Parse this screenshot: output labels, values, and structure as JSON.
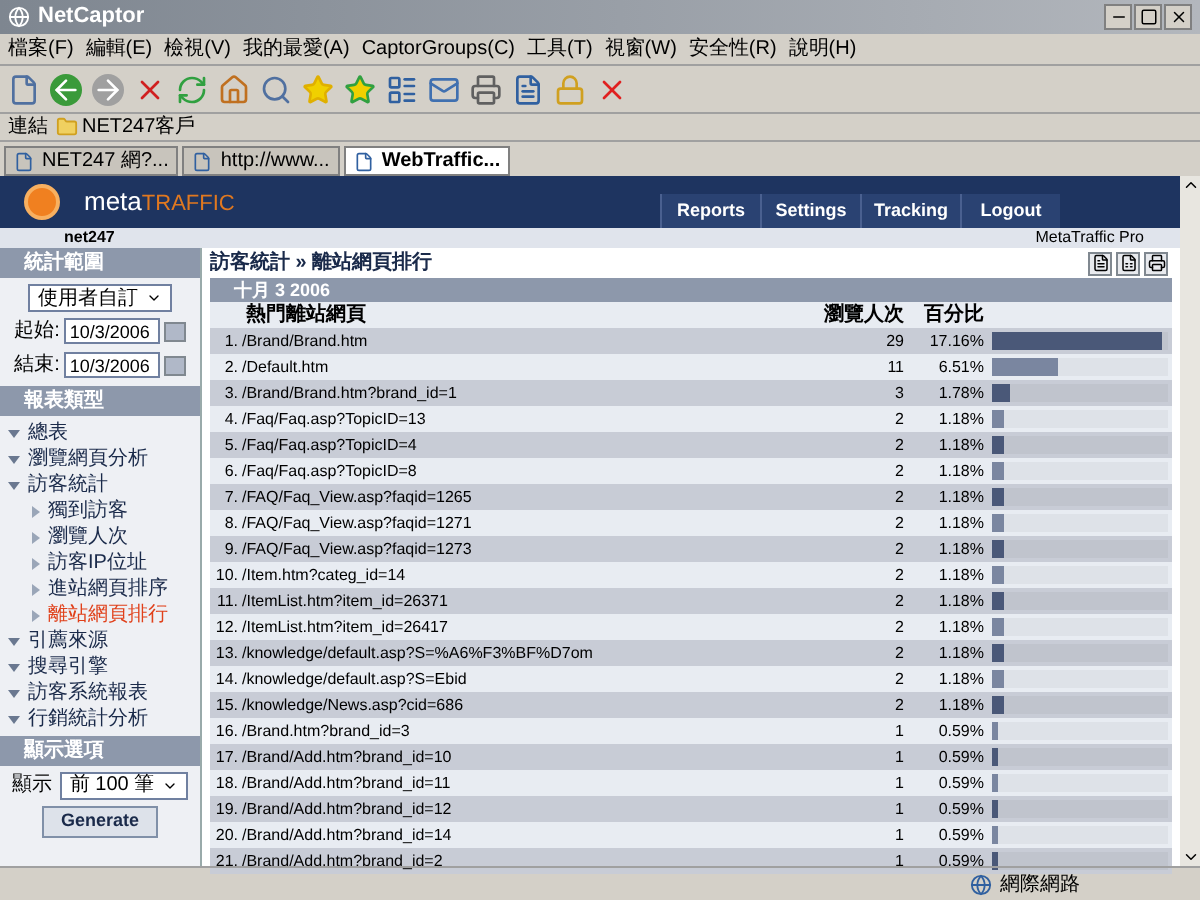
{
  "window": {
    "title": "NetCaptor"
  },
  "menu": [
    "檔案(F)",
    "編輯(E)",
    "檢視(V)",
    "我的最愛(A)",
    "CaptorGroups(C)",
    "工具(T)",
    "視窗(W)",
    "安全性(R)",
    "說明(H)"
  ],
  "links_bar": {
    "label": "連結",
    "items": [
      "NET247客戶"
    ]
  },
  "tabs": [
    {
      "label": "NET247 網?...",
      "selected": false
    },
    {
      "label": "http://www...",
      "selected": false
    },
    {
      "label": "WebTraffic...",
      "selected": true
    }
  ],
  "site": {
    "logo_prefix": "meta",
    "logo_suffix": "TRAFFIC",
    "nav": [
      "Reports",
      "Settings",
      "Tracking",
      "Logout"
    ],
    "account": "net247",
    "edition": "MetaTraffic Pro"
  },
  "sidebar": {
    "date_range": {
      "title": "統計範圍",
      "preset": "使用者自訂",
      "start_label": "起始:",
      "start": "10/3/2006",
      "end_label": "結束:",
      "end": "10/3/2006"
    },
    "report_types": {
      "title": "報表類型",
      "items": [
        {
          "label": "總表",
          "selected": false
        },
        {
          "label": "瀏覽網頁分析",
          "selected": false
        },
        {
          "label": "訪客統計",
          "selected": false,
          "children": [
            {
              "label": "獨到訪客",
              "selected": false
            },
            {
              "label": "瀏覽人次",
              "selected": false
            },
            {
              "label": "訪客IP位址",
              "selected": false
            },
            {
              "label": "進站網頁排序",
              "selected": false
            },
            {
              "label": "離站網頁排行",
              "selected": true
            }
          ]
        },
        {
          "label": "引薦來源",
          "selected": false
        },
        {
          "label": "搜尋引擎",
          "selected": false
        },
        {
          "label": "訪客系統報表",
          "selected": false
        },
        {
          "label": "行銷統計分析",
          "selected": false
        }
      ]
    },
    "display": {
      "title": "顯示選項",
      "label": "顯示",
      "value": "前 100 筆",
      "button": "Generate"
    }
  },
  "content": {
    "breadcrumb": "訪客統計 » 離站網頁排行",
    "table": {
      "date": "十月 3 2006",
      "columns": [
        "熱門離站網頁",
        "瀏覽人次",
        "百分比"
      ],
      "rows": [
        {
          "rank": "1.",
          "page": "/Brand/Brand.htm",
          "count": "29",
          "percent": "17.16%",
          "level": 0.97
        },
        {
          "rank": "2.",
          "page": "/Default.htm",
          "count": "11",
          "percent": "6.51%",
          "level": 0.38
        },
        {
          "rank": "3.",
          "page": "/Brand/Brand.htm?brand_id=1",
          "count": "3",
          "percent": "1.78%",
          "level": 0.1
        },
        {
          "rank": "4.",
          "page": "/Faq/Faq.asp?TopicID=13",
          "count": "2",
          "percent": "1.18%",
          "level": 0.07
        },
        {
          "rank": "5.",
          "page": "/Faq/Faq.asp?TopicID=4",
          "count": "2",
          "percent": "1.18%",
          "level": 0.07
        },
        {
          "rank": "6.",
          "page": "/Faq/Faq.asp?TopicID=8",
          "count": "2",
          "percent": "1.18%",
          "level": 0.07
        },
        {
          "rank": "7.",
          "page": "/FAQ/Faq_View.asp?faqid=1265",
          "count": "2",
          "percent": "1.18%",
          "level": 0.07
        },
        {
          "rank": "8.",
          "page": "/FAQ/Faq_View.asp?faqid=1271",
          "count": "2",
          "percent": "1.18%",
          "level": 0.07
        },
        {
          "rank": "9.",
          "page": "/FAQ/Faq_View.asp?faqid=1273",
          "count": "2",
          "percent": "1.18%",
          "level": 0.07
        },
        {
          "rank": "10.",
          "page": "/Item.htm?categ_id=14",
          "count": "2",
          "percent": "1.18%",
          "level": 0.07
        },
        {
          "rank": "11.",
          "page": "/ItemList.htm?item_id=26371",
          "count": "2",
          "percent": "1.18%",
          "level": 0.07
        },
        {
          "rank": "12.",
          "page": "/ItemList.htm?item_id=26417",
          "count": "2",
          "percent": "1.18%",
          "level": 0.07
        },
        {
          "rank": "13.",
          "page": "/knowledge/default.asp?S=%A6%F3%BF%D7om",
          "count": "2",
          "percent": "1.18%",
          "level": 0.07
        },
        {
          "rank": "14.",
          "page": "/knowledge/default.asp?S=Ebid",
          "count": "2",
          "percent": "1.18%",
          "level": 0.07
        },
        {
          "rank": "15.",
          "page": "/knowledge/News.asp?cid=686",
          "count": "2",
          "percent": "1.18%",
          "level": 0.07
        },
        {
          "rank": "16.",
          "page": "/Brand.htm?brand_id=3",
          "count": "1",
          "percent": "0.59%",
          "level": 0.035
        },
        {
          "rank": "17.",
          "page": "/Brand/Add.htm?brand_id=10",
          "count": "1",
          "percent": "0.59%",
          "level": 0.035
        },
        {
          "rank": "18.",
          "page": "/Brand/Add.htm?brand_id=11",
          "count": "1",
          "percent": "0.59%",
          "level": 0.035
        },
        {
          "rank": "19.",
          "page": "/Brand/Add.htm?brand_id=12",
          "count": "1",
          "percent": "0.59%",
          "level": 0.035
        },
        {
          "rank": "20.",
          "page": "/Brand/Add.htm?brand_id=14",
          "count": "1",
          "percent": "0.59%",
          "level": 0.035
        },
        {
          "rank": "21.",
          "page": "/Brand/Add.htm?brand_id=2",
          "count": "1",
          "percent": "0.59%",
          "level": 0.035
        }
      ]
    }
  },
  "status_bar": {
    "zone": "網際網路"
  }
}
